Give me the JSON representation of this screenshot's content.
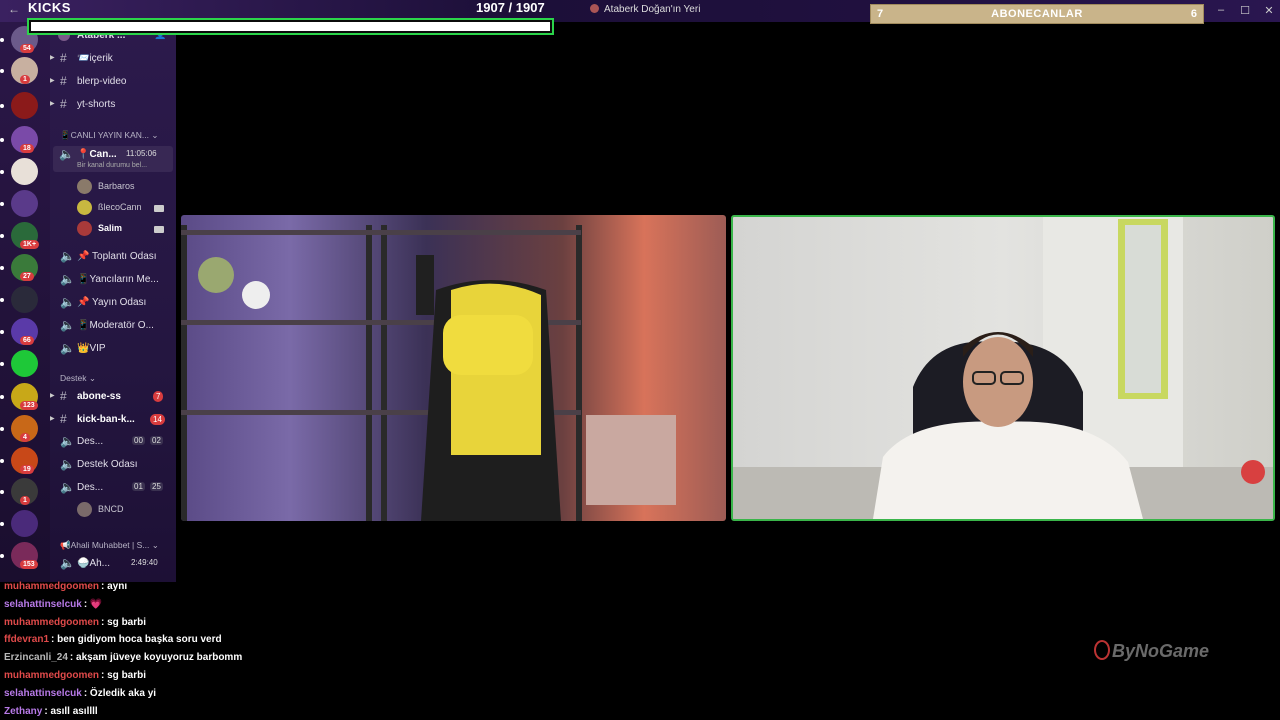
{
  "topbar": {
    "kicks_label": "KICKS",
    "kicks_count": "1907   / 1907",
    "kicks_progress": 1.0,
    "window_title": "Ataberk Doğan'ın Yeri",
    "abone_left": "7",
    "abone_label": "ABONECANLAR",
    "abone_right": "6",
    "minimize": "–",
    "maximize": "☐",
    "close": "✕"
  },
  "servers": [
    {
      "badge": "54",
      "color": "#6b5a8a"
    },
    {
      "badge": "1",
      "color": "#c8b0a0"
    },
    {
      "badge": "",
      "color": "#8b1a1a"
    },
    {
      "badge": "18",
      "color": "#7a4aa8"
    },
    {
      "badge": "",
      "color": "#e8e0d8"
    },
    {
      "badge": "",
      "color": "#5a3a8a"
    },
    {
      "badge": "1K+",
      "color": "#2a6a3a"
    },
    {
      "badge": "27",
      "color": "#3a7a3a"
    },
    {
      "badge": "",
      "color": "#2a2a3a"
    },
    {
      "badge": "66",
      "color": "#5a3aa8"
    },
    {
      "badge": "",
      "color": "#1ec838"
    },
    {
      "badge": "123",
      "color": "#c8a818"
    },
    {
      "badge": "4",
      "color": "#c86818"
    },
    {
      "badge": "19",
      "color": "#c84818"
    },
    {
      "badge": "1",
      "color": "#3a3a3a"
    },
    {
      "badge": "",
      "color": "#4a2a7a"
    },
    {
      "badge": "153",
      "color": "#7a2a5a"
    }
  ],
  "channels": {
    "server_name": "Ataberk ...",
    "items": [
      {
        "type": "text",
        "label": "📨içerik"
      },
      {
        "type": "text",
        "label": "blerp-video"
      },
      {
        "type": "text",
        "label": "yt-shorts"
      }
    ],
    "cat_live": "📱CANLI YAYIN KAN...",
    "live_channel": {
      "label": "📍Can...",
      "time": "11:05:06",
      "status": "Bir kanal durumu bel..."
    },
    "voice_users": [
      {
        "name": "Barbaros",
        "color": "#8a7a6a"
      },
      {
        "name": "ßlecoCann",
        "color": "#c8b840"
      },
      {
        "name": "Salim",
        "color": "#a83a3a"
      }
    ],
    "voice_channels": [
      {
        "label": "📌 Toplantı Odası"
      },
      {
        "label": "📱Yancıların Me..."
      },
      {
        "label": "📌 Yayın Odası"
      },
      {
        "label": "📱Moderatör O..."
      },
      {
        "label": "👑VIP"
      }
    ],
    "cat_destek": "Destek",
    "destek_items": [
      {
        "type": "text",
        "label": "abone-ss",
        "badge": "7"
      },
      {
        "type": "text",
        "label": "kick-ban-k...",
        "badge": "14"
      },
      {
        "type": "voice",
        "label": "Des...",
        "t1": "00",
        "t2": "02"
      },
      {
        "type": "voice",
        "label": "Destek Odası"
      },
      {
        "type": "voice",
        "label": "Des...",
        "t1": "01",
        "t2": "25"
      }
    ],
    "bncd_user": {
      "name": "BNCD",
      "color": "#7a6a6a"
    },
    "cat_ahali": "📢Ahali Muhabbet | S...",
    "ahali_channel": {
      "label": "🍚Ah...",
      "time": "2:49:40"
    }
  },
  "chat": [
    {
      "user": "muhammedgoomen",
      "color": "#e04a4a",
      "text": ": aynı"
    },
    {
      "user": "selahattinselcuk",
      "color": "#b87ae8",
      "text": ": 💗"
    },
    {
      "user": "muhammedgoomen",
      "color": "#e04a4a",
      "text": ": sg barbi"
    },
    {
      "user": "ffdevran1",
      "color": "#e04a4a",
      "text": ": ben gidiyom hoca başka soru verd"
    },
    {
      "user": "Erzincanli_24",
      "color": "#b8b8b8",
      "text": ": akşam jüveye koyuyoruz barbomm"
    },
    {
      "user": "muhammedgoomen",
      "color": "#e04a4a",
      "text": ": sg barbi"
    },
    {
      "user": "selahattinselcuk",
      "color": "#b87ae8",
      "text": ": Özledik aka yi"
    },
    {
      "user": "Zethany",
      "color": "#b87ae8",
      "text": ": asıll asıllll"
    }
  ],
  "watermark": "ByNoGame"
}
